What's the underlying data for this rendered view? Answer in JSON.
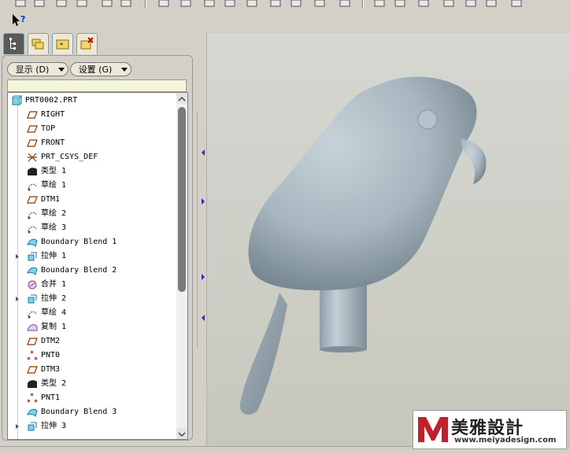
{
  "toolbar": {
    "icons": [
      "new-icon",
      "open-icon",
      "save-icon",
      "print-icon",
      "copy-icon",
      "paste-icon",
      "undo-icon",
      "redo-icon",
      "cut-icon",
      "copy2-icon",
      "paste-special-icon",
      "regenerate-icon",
      "regen-manager-icon",
      "window-icon",
      "repaint-icon",
      "spin-center-icon",
      "orient-icon",
      "zoom-in-icon",
      "zoom-out-icon",
      "refit-icon",
      "view-icon",
      "view-manager-icon"
    ],
    "help_icon": "context-help-icon"
  },
  "navigator_tabs": [
    {
      "name": "model-tree-tab",
      "active": true
    },
    {
      "name": "folder-browser-tab",
      "active": false
    },
    {
      "name": "favorites-tab",
      "active": false
    },
    {
      "name": "connections-tab",
      "active": false
    }
  ],
  "panel": {
    "show_button": "显示 (D)",
    "settings_button": "设置 (G)"
  },
  "model_tree": {
    "root": "PRT0002.PRT",
    "items": [
      {
        "label": "RIGHT",
        "icon": "datum-plane-icon",
        "expandable": false
      },
      {
        "label": "TOP",
        "icon": "datum-plane-icon",
        "expandable": false
      },
      {
        "label": "FRONT",
        "icon": "datum-plane-icon",
        "expandable": false
      },
      {
        "label": "PRT_CSYS_DEF",
        "icon": "csys-icon",
        "expandable": false
      },
      {
        "label": "类型 1",
        "icon": "type-feature-icon",
        "expandable": false
      },
      {
        "label": "草绘 1",
        "icon": "sketch-icon",
        "expandable": false
      },
      {
        "label": "DTM1",
        "icon": "datum-plane-icon",
        "expandable": false
      },
      {
        "label": "草绘 2",
        "icon": "sketch-icon",
        "expandable": false
      },
      {
        "label": "草绘 3",
        "icon": "sketch-icon",
        "expandable": false
      },
      {
        "label": "Boundary Blend 1",
        "icon": "boundary-blend-icon",
        "expandable": false
      },
      {
        "label": "拉伸 1",
        "icon": "extrude-icon",
        "expandable": true
      },
      {
        "label": "Boundary Blend 2",
        "icon": "boundary-blend-icon",
        "expandable": false
      },
      {
        "label": "合并 1",
        "icon": "merge-icon",
        "expandable": false
      },
      {
        "label": "拉伸 2",
        "icon": "extrude-icon",
        "expandable": true
      },
      {
        "label": "草绘 4",
        "icon": "sketch-icon",
        "expandable": false
      },
      {
        "label": "复制 1",
        "icon": "copy-feature-icon",
        "expandable": false
      },
      {
        "label": "DTM2",
        "icon": "datum-plane-icon",
        "expandable": false
      },
      {
        "label": "PNT0",
        "icon": "datum-point-icon",
        "expandable": false
      },
      {
        "label": "DTM3",
        "icon": "datum-plane-icon",
        "expandable": false
      },
      {
        "label": "类型 2",
        "icon": "type-feature-icon",
        "expandable": false
      },
      {
        "label": "PNT1",
        "icon": "datum-point-icon",
        "expandable": false
      },
      {
        "label": "Boundary Blend 3",
        "icon": "boundary-blend-icon",
        "expandable": false
      },
      {
        "label": "拉伸 3",
        "icon": "extrude-icon",
        "expandable": true
      }
    ]
  },
  "watermark": {
    "brand": "美雅設計",
    "url": "www.meiyadesign.com"
  },
  "colors": {
    "model_surface": "#a9b7c0",
    "viewport_bg": "#d2d2ca",
    "tree_bg": "#ffffff",
    "active_tab": "#5a5a5a",
    "logo_red": "#c0202a"
  }
}
